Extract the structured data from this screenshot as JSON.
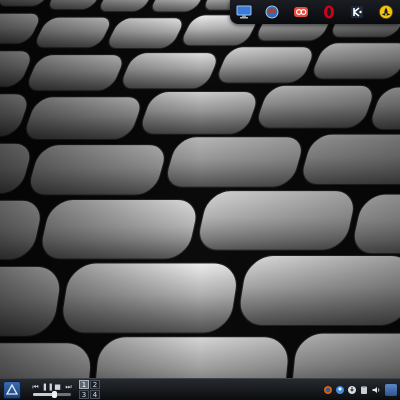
{
  "desktop": {
    "wallpaper": "warped-grey-tile-grid"
  },
  "dock": {
    "icons": [
      {
        "name": "desktop-monitor-icon",
        "color": "#3a7bd5"
      },
      {
        "name": "network-globe-icon",
        "color": "#c0392b"
      },
      {
        "name": "openoffice-icon",
        "color": "#e74c3c"
      },
      {
        "name": "opera-browser-icon",
        "color": "#d0021b"
      },
      {
        "name": "kde-gear-icon",
        "color": "#ffffff"
      },
      {
        "name": "hazard-warning-icon",
        "color": "#f1c40f"
      }
    ]
  },
  "panel": {
    "media_controls": [
      "previous-icon",
      "pause-icon",
      "stop-icon",
      "next-icon"
    ],
    "seek_progress": 0.55,
    "pager": {
      "desktops": [
        "1",
        "2",
        "3",
        "4"
      ],
      "active_index": 0
    },
    "tray": [
      "firefox-icon",
      "kopete-icon",
      "update-icon",
      "clipboard-icon",
      "volume-icon",
      "network-icon"
    ],
    "accent": "#3b6fb6"
  }
}
